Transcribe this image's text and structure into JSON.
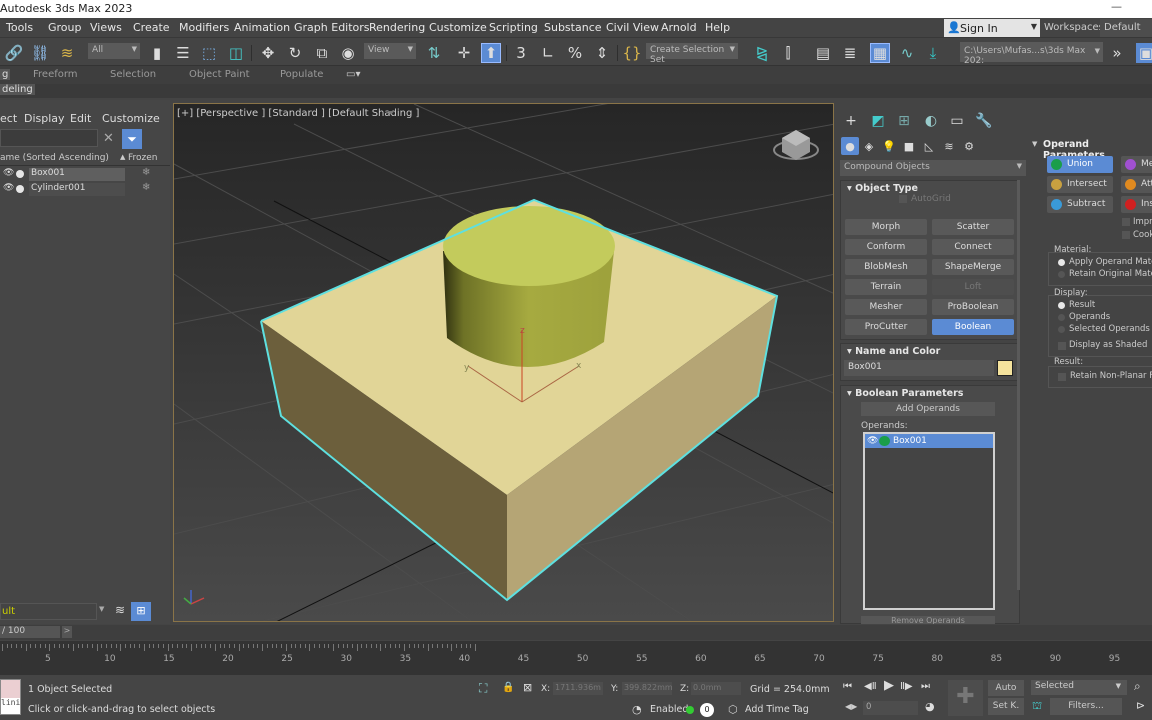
{
  "app": {
    "title": "Autodesk 3ds Max 2023",
    "minimize_icon": "minimize-icon"
  },
  "menubar": {
    "items": [
      "Tools",
      "Group",
      "Views",
      "Create",
      "Modifiers",
      "Animation",
      "Graph Editors",
      "Rendering",
      "Customize",
      "Scripting",
      "Substance",
      "Civil View",
      "Arnold",
      "Help"
    ],
    "sign_in": "Sign In",
    "workspaces_label": "Workspaces:",
    "workspaces_value": "Default"
  },
  "toolbar": {
    "selection_filter": "All",
    "ref_coord": "View",
    "selection_set": "Create Selection Set",
    "project_path": "C:\\Users\\Mufas...s\\3ds Max 202:",
    "icons": [
      "link-icon",
      "unlink-icon",
      "bind-space-warp-icon",
      "select-object-icon",
      "select-by-name-icon",
      "rect-selection-region-icon",
      "window-crossing-icon",
      "move-icon",
      "rotate-icon",
      "scale-icon",
      "place-icon",
      "use-pivot-icon",
      "snaps-toggle-icon",
      "angle-snap-icon",
      "percent-snap-icon",
      "spinner-snap-icon",
      "edit-named-selection-icon",
      "mirror-icon",
      "align-icon",
      "scene-explorer-icon",
      "layer-explorer-icon",
      "toggle-ribbon-icon",
      "curve-editor-icon",
      "render-setup-icon"
    ]
  },
  "ribbon": {
    "tabs": [
      "g",
      "Freeform",
      "Selection",
      "Object Paint",
      "Populate"
    ],
    "subtab": "deling"
  },
  "scene_explorer": {
    "menu": [
      "ect",
      "Display",
      "Edit",
      "Customize"
    ],
    "search_placeholder": "",
    "column_name": "ame (Sorted Ascending)",
    "column_frozen": "Frozen",
    "sort_indicator": "▲",
    "rows": [
      {
        "name": "Box001",
        "selected": true
      },
      {
        "name": "Cylinder001",
        "selected": false
      }
    ],
    "layer": "ult"
  },
  "viewport": {
    "label": "[+] [Perspective ] [Standard ] [Default Shading ]",
    "axis_labels": {
      "x": "x",
      "y": "y",
      "z": "z"
    },
    "selection_color": "#5ee0e0",
    "box_color": "#e0d596",
    "cylinder_color": "#c3cb5c"
  },
  "command_panel": {
    "tabs": [
      "create-tab",
      "modify-tab",
      "hierarchy-tab",
      "motion-tab",
      "display-tab",
      "utilities-tab"
    ],
    "subtabs": [
      "geometry",
      "shapes",
      "lights",
      "cameras",
      "helpers",
      "space-warps",
      "systems"
    ],
    "category": "Compound Objects",
    "object_type": {
      "title": "Object Type",
      "autogrid": "AutoGrid",
      "buttons": [
        {
          "label": "Morph",
          "state": "normal"
        },
        {
          "label": "Scatter",
          "state": "normal"
        },
        {
          "label": "Conform",
          "state": "normal"
        },
        {
          "label": "Connect",
          "state": "normal"
        },
        {
          "label": "BlobMesh",
          "state": "normal"
        },
        {
          "label": "ShapeMerge",
          "state": "normal"
        },
        {
          "label": "Terrain",
          "state": "normal"
        },
        {
          "label": "Loft",
          "state": "disabled"
        },
        {
          "label": "Mesher",
          "state": "normal"
        },
        {
          "label": "ProBoolean",
          "state": "normal"
        },
        {
          "label": "ProCutter",
          "state": "normal"
        },
        {
          "label": "Boolean",
          "state": "active"
        }
      ]
    },
    "name_and_color": {
      "title": "Name and Color",
      "name": "Box001",
      "color": "#f5e39d"
    },
    "boolean_parameters": {
      "title": "Boolean Parameters",
      "add_operands": "Add Operands",
      "operands_label": "Operands:",
      "operands": [
        "Box001"
      ],
      "remove_operands": "Remove Operands"
    }
  },
  "operand_parameters": {
    "title": "Operand Parameters",
    "ops": [
      {
        "label": "Union",
        "active": true,
        "color": "#1a9e4a"
      },
      {
        "label": "Mer",
        "active": false,
        "color": "#a050d0"
      },
      {
        "label": "Intersect",
        "active": false,
        "color": "#c8a040"
      },
      {
        "label": "Atta",
        "active": false,
        "color": "#e08a20"
      },
      {
        "label": "Subtract",
        "active": false,
        "color": "#3a9ad8"
      },
      {
        "label": "Inse",
        "active": false,
        "color": "#d02020"
      }
    ],
    "imprint": "Impr",
    "cookie": "Cook",
    "material_label": "Material:",
    "material_options": [
      {
        "label": "Apply Operand Materi",
        "checked": true
      },
      {
        "label": "Retain Original Materi",
        "checked": false
      }
    ],
    "display_label": "Display:",
    "display_options": [
      {
        "label": "Result",
        "checked": true
      },
      {
        "label": "Operands",
        "checked": false
      },
      {
        "label": "Selected Operands",
        "checked": false
      }
    ],
    "display_as_shaded": "Display as Shaded",
    "result_label": "Result:",
    "retain_non_planar": "Retain Non-Planar Fa"
  },
  "timeline": {
    "frame_field": "/ 100",
    "next": ">",
    "ticks": [
      "5",
      "10",
      "15",
      "20",
      "25",
      "30",
      "35",
      "40",
      "45",
      "50",
      "55",
      "60",
      "65",
      "70",
      "75",
      "80",
      "85",
      "90",
      "95"
    ]
  },
  "status": {
    "selected": "1 Object Selected",
    "prompt": "Click or click-and-drag to select objects",
    "maxscript_text": "lini",
    "x_label": "X:",
    "x_value": "1711.936m",
    "y_label": "Y:",
    "y_value": "399.822mm",
    "z_label": "Z:",
    "z_value": "0.0mm",
    "grid": "Grid = 254.0mm",
    "enabled_label": "Enabled:",
    "enabled_count": "0",
    "add_time_tag": "Add Time Tag",
    "current_frame": "0",
    "auto": "Auto",
    "set_key": "Set K.",
    "key_filter": "Selected",
    "filters": "Filters..."
  }
}
